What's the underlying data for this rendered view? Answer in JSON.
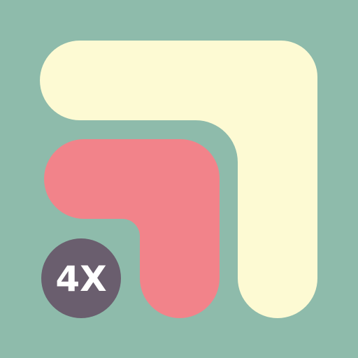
{
  "icon": {
    "badge_text": "4X",
    "colors": {
      "background": "#8EBBAB",
      "large_shape": "#FDFAD3",
      "small_shape": "#F2838A",
      "badge_fill": "#6A5E6E",
      "badge_text": "#FFFFFF"
    }
  }
}
